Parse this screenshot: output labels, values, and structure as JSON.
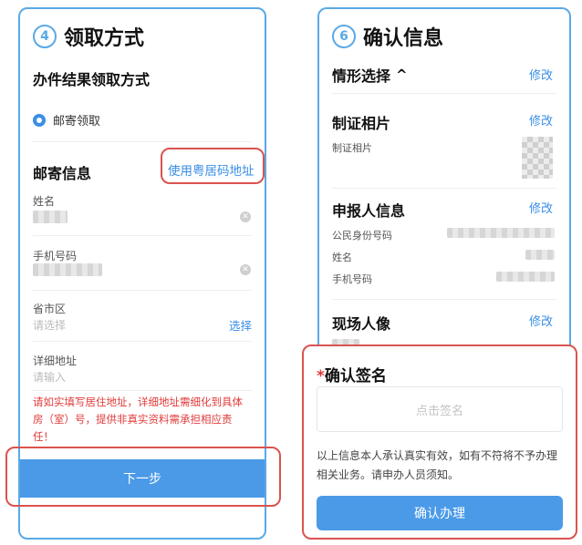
{
  "left": {
    "step_number": "4",
    "step_title": "领取方式",
    "section_title": "办件结果领取方式",
    "radio_option": "邮寄领取",
    "mail_section_title": "邮寄信息",
    "use_address_link": "使用粤居码地址",
    "fields": {
      "name_label": "姓名",
      "phone_label": "手机号码",
      "region_label": "省市区",
      "region_placeholder": "请选择",
      "region_select": "选择",
      "address_label": "详细地址",
      "address_placeholder": "请输入"
    },
    "warning": "请如实填写居住地址，详细地址需细化到具体房（室）号，提供非真实资料需承担相应责任！",
    "next_button": "下一步"
  },
  "right": {
    "step_number": "6",
    "step_title": "确认信息",
    "scenario_title": "情形选择",
    "scenario_chevron": "^",
    "edit_label": "修改",
    "photo_title": "制证相片",
    "photo_label": "制证相片",
    "applicant_title": "申报人信息",
    "applicant_fields": {
      "id_label": "公民身份号码",
      "name_label": "姓名",
      "phone_label": "手机号码"
    },
    "portrait_title": "现场人像",
    "signature_star": "*",
    "signature_title": "确认签名",
    "signature_placeholder": "点击签名",
    "notice": "以上信息本人承认真实有效，如有不符将不予办理相关业务。请申办人员须知。",
    "confirm_button": "确认办理"
  },
  "colors": {
    "accent": "#4a9ae8",
    "border": "#5aa9e6",
    "highlight": "#d9534f",
    "warning": "#e03a3a"
  },
  "icons": {
    "clear": "clear-icon",
    "radio": "radio-checked-icon"
  }
}
